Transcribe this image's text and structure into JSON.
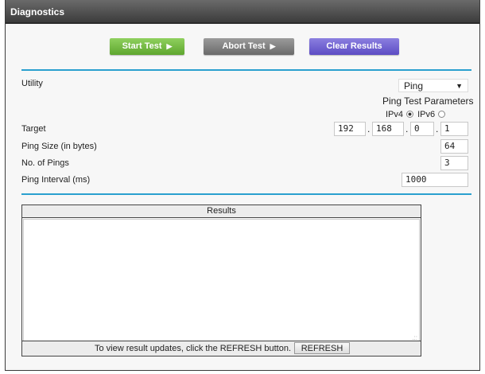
{
  "window": {
    "title": "Diagnostics"
  },
  "toolbar": {
    "start_label": "Start Test",
    "abort_label": "Abort Test",
    "clear_label": "Clear Results",
    "arrow_glyph": "▶"
  },
  "form": {
    "utility_label": "Utility",
    "utility_value": "Ping",
    "params_heading": "Ping Test Parameters",
    "ipv4_label": "IPv4",
    "ipv6_label": "IPv6",
    "ip_selected": "IPv4",
    "target_label": "Target",
    "target_octets": [
      "192",
      "168",
      "0",
      "1"
    ],
    "ping_size_label": "Ping Size (in bytes)",
    "ping_size_value": "64",
    "num_pings_label": "No. of Pings",
    "num_pings_value": "3",
    "interval_label": "Ping Interval (ms)",
    "interval_value": "1000"
  },
  "results": {
    "header": "Results",
    "body": "",
    "footer_text": "To view result updates, click the REFRESH button.",
    "refresh_label": "REFRESH"
  },
  "colors": {
    "start": "#6fba3e",
    "abort": "#808080",
    "clear": "#6c5fd4",
    "rule": "#2aa0cf",
    "titlebar": "#4a4a4a"
  },
  "icons": {
    "dropdown": "chevron-down-icon",
    "play": "play-arrow-icon",
    "resize": "resize-grip-icon"
  }
}
